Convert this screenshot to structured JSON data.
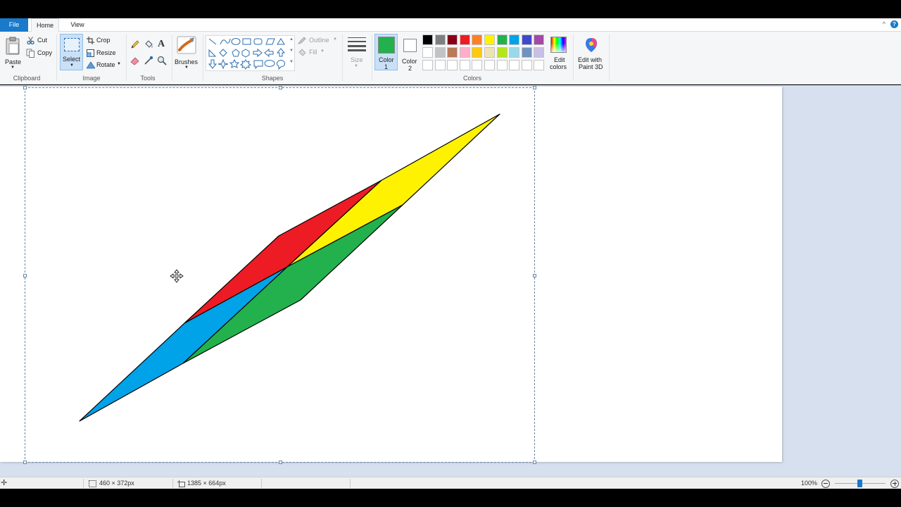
{
  "menu": {
    "file": "File",
    "home": "Home",
    "view": "View",
    "minimize_ribbon": "^",
    "help": "?"
  },
  "ribbon": {
    "clipboard": {
      "group": "Clipboard",
      "paste": "Paste",
      "cut": "Cut",
      "copy": "Copy"
    },
    "image": {
      "group": "Image",
      "select": "Select",
      "crop": "Crop",
      "resize": "Resize",
      "rotate": "Rotate"
    },
    "tools": {
      "group": "Tools"
    },
    "brushes": {
      "label": "Brushes"
    },
    "shapes": {
      "group": "Shapes",
      "outline": "Outline",
      "fill": "Fill"
    },
    "size": {
      "label": "Size"
    },
    "colors": {
      "group": "Colors",
      "color1_line1": "Color",
      "color1_line2": "1",
      "color2_line1": "Color",
      "color2_line2": "2",
      "edit_colors_line1": "Edit",
      "edit_colors_line2": "colors",
      "paint3d_line1": "Edit with",
      "paint3d_line2": "Paint 3D",
      "color1_value": "#22b14c",
      "color2_value": "#ffffff",
      "palette_row1": [
        "#000000",
        "#7f7f7f",
        "#880015",
        "#ed1c24",
        "#ff7f27",
        "#fff200",
        "#22b14c",
        "#00a2e8",
        "#3f48cc",
        "#a349a4"
      ],
      "palette_row2": [
        "#ffffff",
        "#c3c3c3",
        "#b97a57",
        "#ffaec9",
        "#ffc90e",
        "#efe4b0",
        "#b5e61d",
        "#99d9ea",
        "#7092be",
        "#c8bfe7"
      ]
    }
  },
  "drawing": {
    "colors": {
      "red": "#ed1c24",
      "yellow": "#fff200",
      "blue": "#00a2e8",
      "green": "#22b14c"
    }
  },
  "status": {
    "selection_size": "460 × 372px",
    "canvas_size": "1385 × 664px",
    "zoom": "100%"
  }
}
